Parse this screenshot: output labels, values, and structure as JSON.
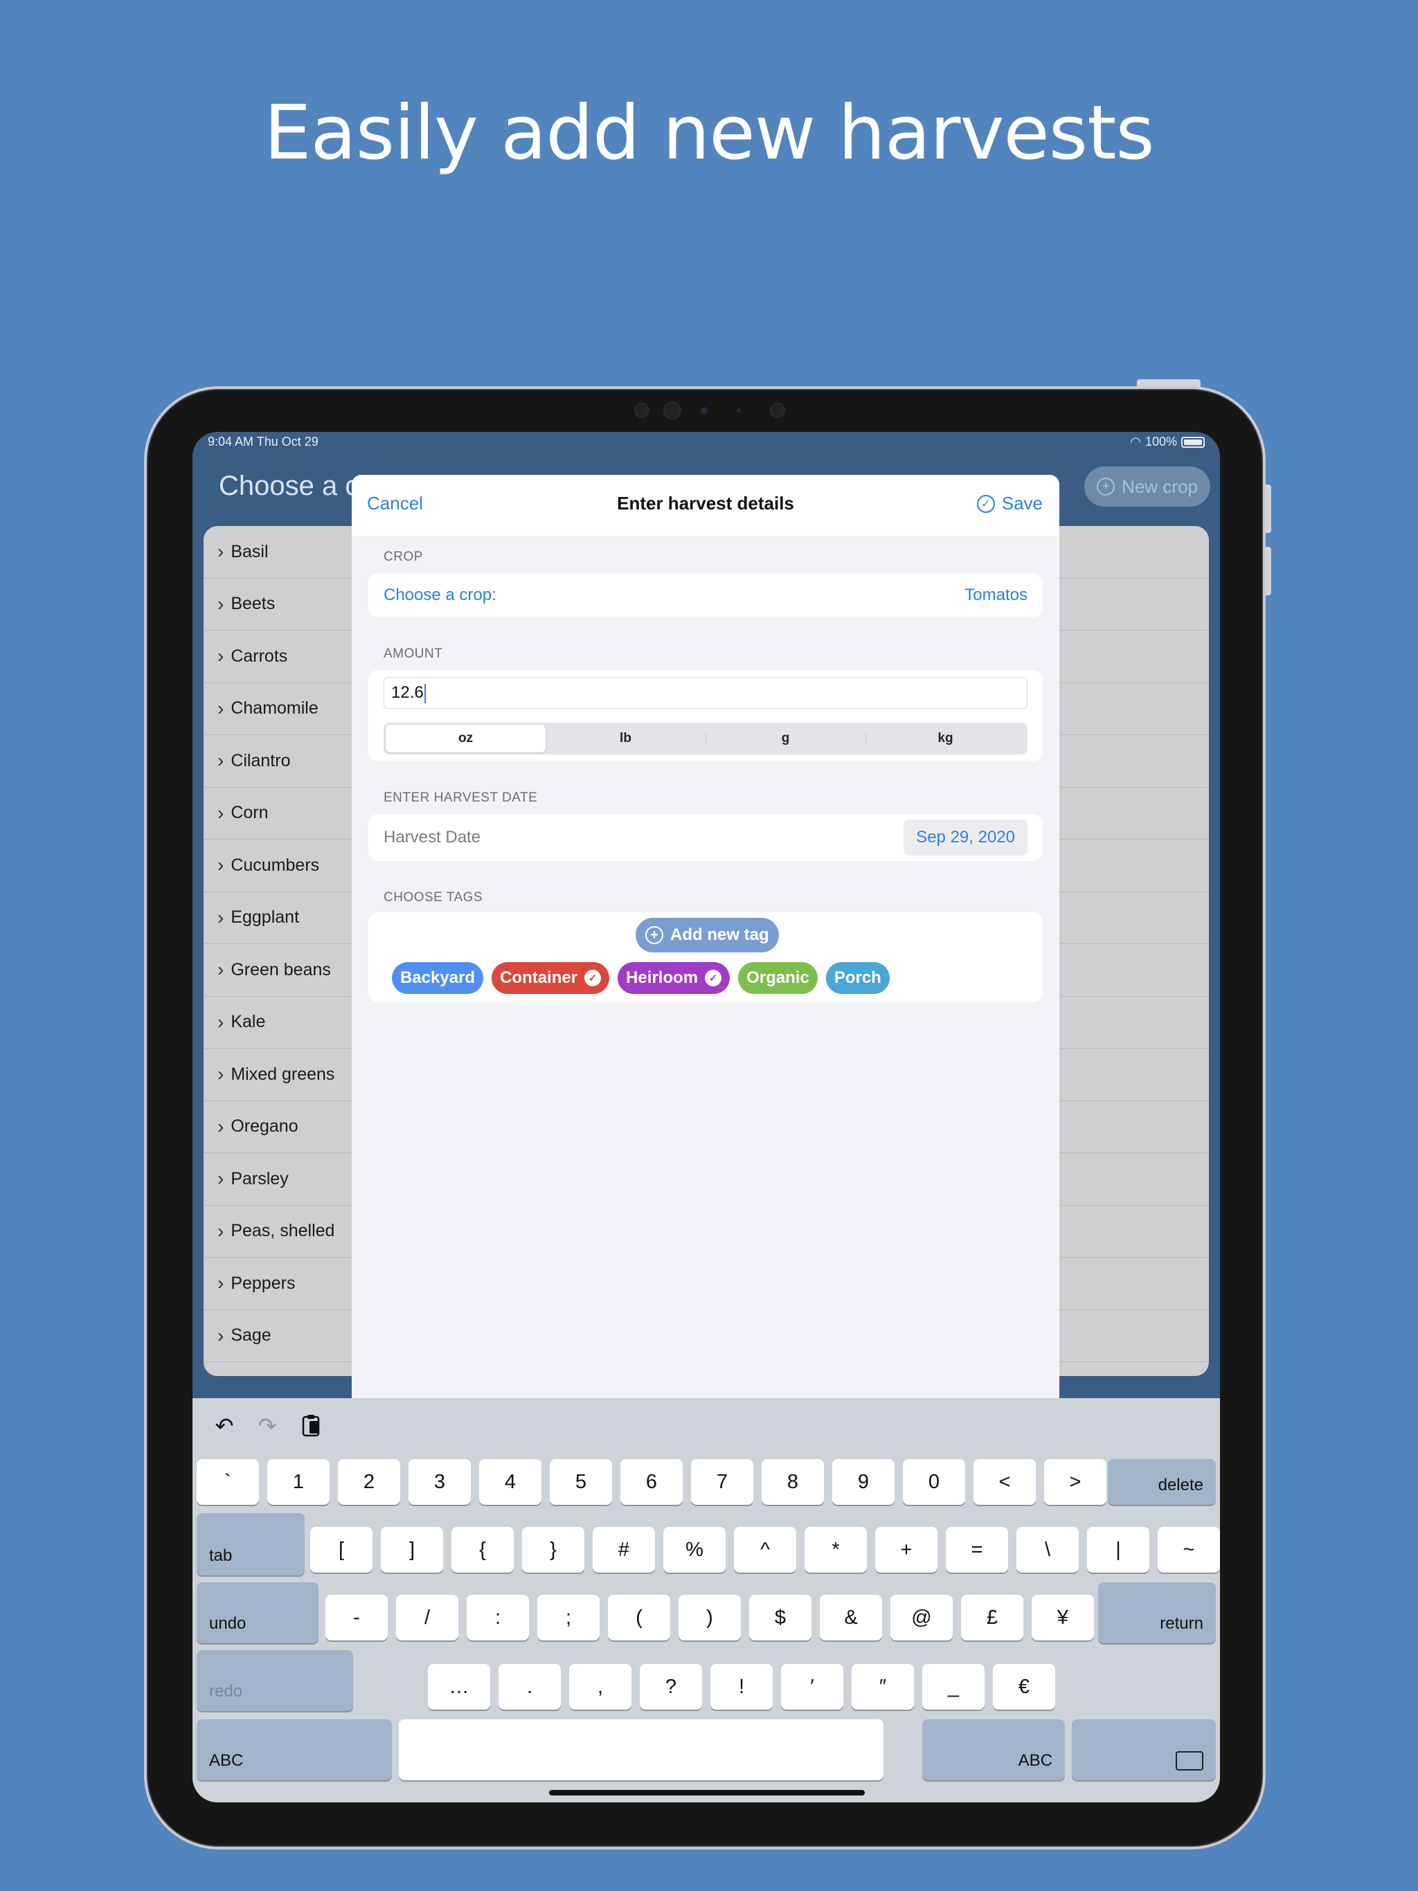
{
  "headline": "Easily add new harvests",
  "status_bar": {
    "time": "9:04 AM   Thu Oct 29",
    "battery": "100%"
  },
  "background_app": {
    "title": "Choose a c",
    "new_crop_button": "New crop",
    "crops": [
      "Basil",
      "Beets",
      "Carrots",
      "Chamomile",
      "Cilantro",
      "Corn",
      "Cucumbers",
      "Eggplant",
      "Green beans",
      "Kale",
      "Mixed greens",
      "Oregano",
      "Parsley",
      "Peas, shelled",
      "Peppers",
      "Sage"
    ]
  },
  "modal": {
    "cancel": "Cancel",
    "title": "Enter harvest details",
    "save": "Save",
    "crop_section": "CROP",
    "crop_label": "Choose a crop:",
    "crop_value": "Tomatos",
    "amount_section": "AMOUNT",
    "amount_value": "12.6",
    "units": [
      "oz",
      "lb",
      "g",
      "kg"
    ],
    "selected_unit": "oz",
    "date_section": "ENTER HARVEST DATE",
    "date_label": "Harvest Date",
    "date_value": "Sep 29, 2020",
    "tags_section": "CHOOSE TAGS",
    "add_tag": "Add new tag",
    "tags": [
      {
        "label": "Backyard",
        "color": "#4f8ff0",
        "selected": false
      },
      {
        "label": "Container",
        "color": "#d9483a",
        "selected": true
      },
      {
        "label": "Heirloom",
        "color": "#a03cc8",
        "selected": true
      },
      {
        "label": "Organic",
        "color": "#7cbf4c",
        "selected": false
      },
      {
        "label": "Porch",
        "color": "#4aa6d8",
        "selected": false
      }
    ]
  },
  "keyboard": {
    "row1": [
      "`",
      "1",
      "2",
      "3",
      "4",
      "5",
      "6",
      "7",
      "8",
      "9",
      "0",
      "<",
      ">"
    ],
    "row1_end": "delete",
    "row2_start": "tab",
    "row2": [
      "[",
      "]",
      "{",
      "}",
      "#",
      "%",
      "^",
      "*",
      "+",
      "=",
      "\\",
      "|",
      "~"
    ],
    "row3_start": "undo",
    "row3": [
      "-",
      "/",
      ":",
      ";",
      "(",
      ")",
      "$",
      "&",
      "@",
      "£",
      "¥"
    ],
    "row3_end": "return",
    "row4_start": "redo",
    "row4": [
      "…",
      ".",
      ",",
      "?",
      "!",
      "′",
      "″",
      "_",
      "€"
    ],
    "row5_left": "ABC",
    "row5_right": "ABC"
  },
  "colors": {
    "accent": "#2a82dc",
    "background": "#5284be"
  }
}
